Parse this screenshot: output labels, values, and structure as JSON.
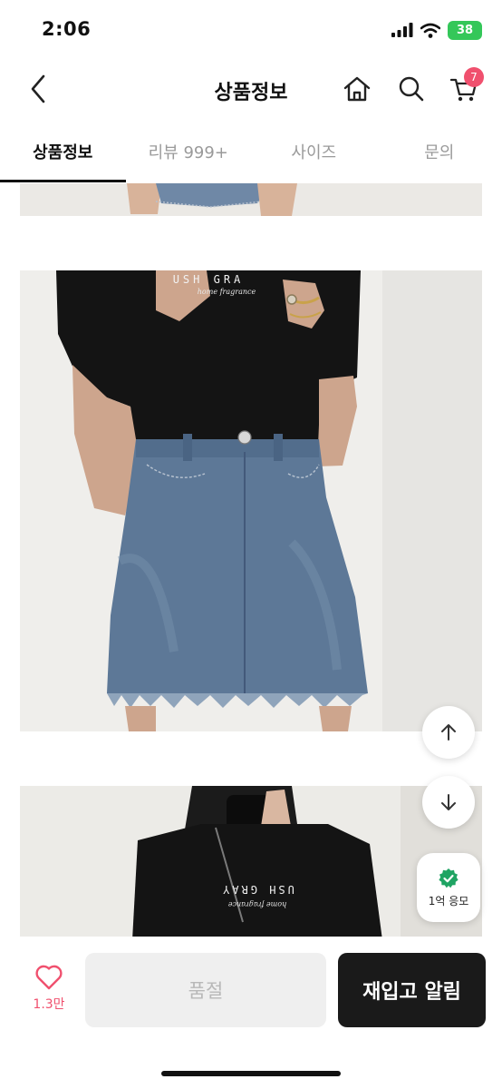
{
  "status_bar": {
    "time": "2:06",
    "battery": "38"
  },
  "header": {
    "title": "상품정보",
    "cart_badge": "7"
  },
  "tabs": [
    {
      "label": "상품정보",
      "active": true
    },
    {
      "label": "리뷰 999+",
      "active": false
    },
    {
      "label": "사이즈",
      "active": false
    },
    {
      "label": "문의",
      "active": false
    }
  ],
  "photos": {
    "main_shirt_print": "USH GRA",
    "main_shirt_print_sub": "home fragrance",
    "third_shirt_print": "USH GRAY",
    "third_shirt_print_sub": "home fragrance"
  },
  "float": {
    "entry_label": "1억 응모"
  },
  "bottom": {
    "like_count": "1.3만",
    "soldout_label": "품절",
    "restock_label": "재입고 알림"
  },
  "colors": {
    "accent": "#f0506e",
    "entry_check": "#1fa463",
    "battery": "#34c759"
  },
  "icons": [
    "chevron-left-icon",
    "home-icon",
    "search-icon",
    "cart-icon",
    "arrow-up-icon",
    "arrow-down-icon",
    "check-badge-icon",
    "heart-icon"
  ]
}
